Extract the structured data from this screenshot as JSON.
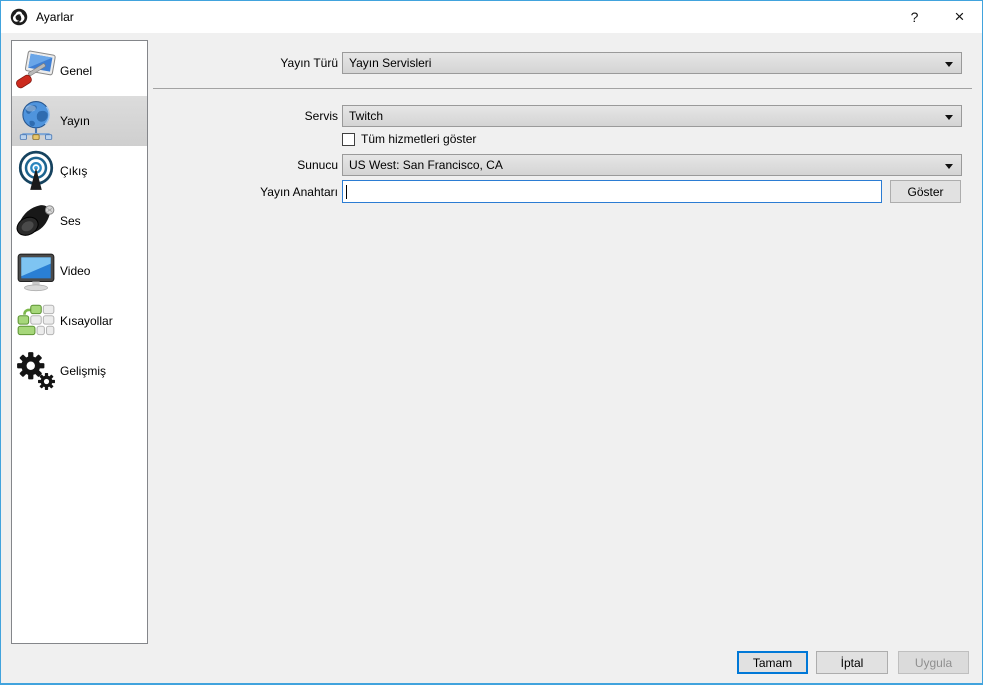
{
  "window": {
    "title": "Ayarlar",
    "help_label": "?",
    "close_label": "×"
  },
  "sidebar": {
    "items": [
      {
        "label": "Genel",
        "icon": "display-config-icon",
        "selected": false
      },
      {
        "label": "Yayın",
        "icon": "globe-icon",
        "selected": true
      },
      {
        "label": "Çıkış",
        "icon": "broadcast-icon",
        "selected": false
      },
      {
        "label": "Ses",
        "icon": "speaker-icon",
        "selected": false
      },
      {
        "label": "Video",
        "icon": "monitor-icon",
        "selected": false
      },
      {
        "label": "Kısayollar",
        "icon": "hotkeys-icon",
        "selected": false
      },
      {
        "label": "Gelişmiş",
        "icon": "gears-icon",
        "selected": false
      }
    ]
  },
  "form": {
    "stream_type": {
      "label": "Yayın Türü",
      "value": "Yayın Servisleri"
    },
    "service": {
      "label": "Servis",
      "value": "Twitch"
    },
    "show_all": {
      "label": "Tüm hizmetleri göster",
      "checked": false
    },
    "server": {
      "label": "Sunucu",
      "value": "US West: San Francisco, CA"
    },
    "stream_key": {
      "label": "Yayın Anahtarı",
      "value": "",
      "show_button": "Göster"
    }
  },
  "footer": {
    "ok": "Tamam",
    "cancel": "İptal",
    "apply": "Uygula"
  },
  "colors": {
    "window_border": "#41a3dd",
    "accent": "#0078d7",
    "dialog_bg": "#f0f0f0",
    "selected_item_bg": "#d4d4d4"
  }
}
